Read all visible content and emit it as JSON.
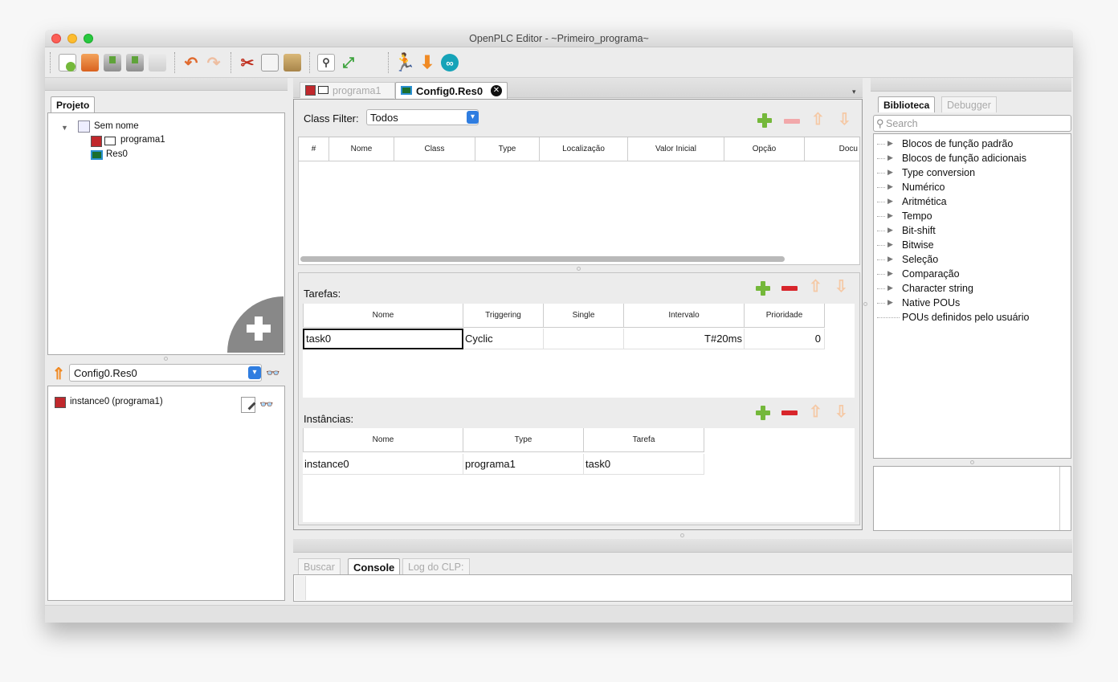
{
  "window": {
    "title": "OpenPLC Editor - ~Primeiro_programa~"
  },
  "toolbar": {
    "buttons": [
      "new-file-icon",
      "open-folder-icon",
      "save-icon",
      "save-as-icon",
      "print-icon",
      "undo-icon",
      "redo-icon",
      "cut-icon",
      "copy-icon",
      "paste-icon",
      "search-icon",
      "fullscreen-icon",
      "run-icon",
      "download-icon",
      "arduino-icon"
    ]
  },
  "project_panel": {
    "tab": "Projeto",
    "tree": {
      "root": "Sem nome",
      "children": [
        "programa1",
        "Res0"
      ]
    }
  },
  "instance_panel": {
    "selected": "Config0.Res0",
    "items": [
      "instance0 (programa1)"
    ]
  },
  "editor_tabs": [
    {
      "label": "programa1",
      "active": false
    },
    {
      "label": "Config0.Res0",
      "active": true
    }
  ],
  "variables": {
    "filter_label": "Class Filter:",
    "filter_value": "Todos",
    "columns": [
      "#",
      "Nome",
      "Class",
      "Type",
      "Localização",
      "Valor Inicial",
      "Opção",
      "Docu"
    ]
  },
  "tasks": {
    "label": "Tarefas:",
    "columns": [
      "Nome",
      "Triggering",
      "Single",
      "Intervalo",
      "Prioridade"
    ],
    "rows": [
      {
        "nome": "task0",
        "triggering": "Cyclic",
        "single": "",
        "intervalo": "T#20ms",
        "prioridade": "0"
      }
    ]
  },
  "instances": {
    "label": "Instâncias:",
    "columns": [
      "Nome",
      "Type",
      "Tarefa"
    ],
    "rows": [
      {
        "nome": "instance0",
        "type": "programa1",
        "tarefa": "task0"
      }
    ]
  },
  "library": {
    "tabs": [
      "Biblioteca",
      "Debugger"
    ],
    "search_placeholder": "Search",
    "items": [
      "Blocos de função padrão",
      "Blocos de função adicionais",
      "Type conversion",
      "Numérico",
      "Aritmética",
      "Tempo",
      "Bit-shift",
      "Bitwise",
      "Seleção",
      "Comparação",
      "Character string",
      "Native POUs"
    ],
    "leaf": "POUs definidos pelo usuário"
  },
  "bottom_tabs": [
    "Buscar",
    "Console",
    "Log do CLP:"
  ],
  "colors": {
    "green": "#74b83a",
    "red": "#d8252b",
    "orange": "#f08a24",
    "blue": "#2f7de0"
  }
}
